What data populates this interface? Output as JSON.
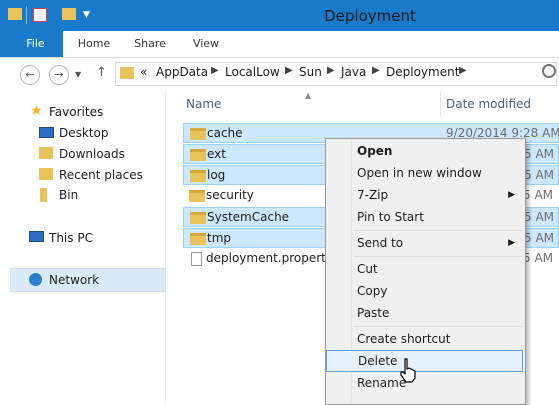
{
  "window": {
    "title": "Deployment"
  },
  "ribbon": {
    "tabs": [
      "File",
      "Home",
      "Share",
      "View"
    ]
  },
  "address": {
    "prefix": "«",
    "crumbs": [
      "AppData",
      "LocalLow",
      "Sun",
      "Java",
      "Deployment"
    ]
  },
  "navpane": {
    "favorites_label": "Favorites",
    "favorites": [
      "Desktop",
      "Downloads",
      "Recent places",
      "Bin"
    ],
    "thispc_label": "This PC",
    "network_label": "Network"
  },
  "columns": {
    "name": "Name",
    "date": "Date modified"
  },
  "files": [
    {
      "name": "cache",
      "date": "9/20/2014 9:28 AM",
      "type": "folder",
      "selected": true
    },
    {
      "name": "ext",
      "date": "5 AM",
      "type": "folder",
      "selected": true
    },
    {
      "name": "log",
      "date": "5 AM",
      "type": "folder",
      "selected": true
    },
    {
      "name": "security",
      "date": "5 AM",
      "type": "folder",
      "selected": false
    },
    {
      "name": "SystemCache",
      "date": "5 AM",
      "type": "folder",
      "selected": true
    },
    {
      "name": "tmp",
      "date": "5 AM",
      "type": "folder",
      "selected": true
    },
    {
      "name": "deployment.propertie",
      "date": "5 AM",
      "type": "file",
      "selected": false
    }
  ],
  "context_menu": {
    "items": [
      {
        "label": "Open",
        "bold": true
      },
      {
        "label": "Open in new window"
      },
      {
        "label": "7-Zip",
        "submenu": true
      },
      {
        "label": "Pin to Start"
      },
      {
        "label": "Send to",
        "submenu": true
      },
      {
        "label": "Cut"
      },
      {
        "label": "Copy"
      },
      {
        "label": "Paste"
      },
      {
        "label": "Create shortcut"
      },
      {
        "label": "Delete",
        "highlighted": true
      },
      {
        "label": "Rename"
      }
    ],
    "submenu_arrow": "▶"
  },
  "colors": {
    "accent": "#1979ca",
    "selection": "#cce8ff",
    "folder": "#e8c35a"
  }
}
